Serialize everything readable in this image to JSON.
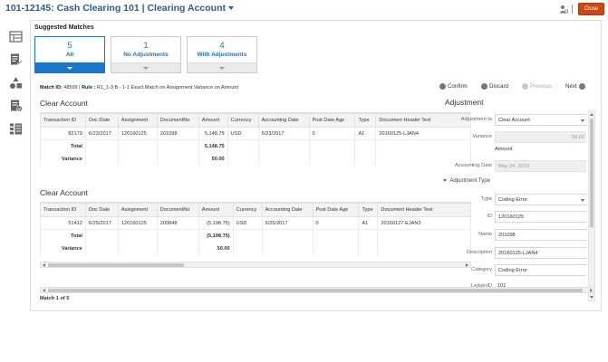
{
  "header": {
    "title": "101-12145: Cash Clearing 101 | Clearing Account",
    "close_label": "Close"
  },
  "suggested": {
    "title": "Suggested Matches",
    "tabs": [
      {
        "count": "5",
        "label": "All"
      },
      {
        "count": "1",
        "label": "No Adjustments"
      },
      {
        "count": "4",
        "label": "With Adjustments"
      }
    ]
  },
  "match": {
    "id_label": "Match ID:",
    "id_value": "48599",
    "rule_label": "Rule :",
    "rule_value": "R1_1-3 B - 1-1 Exact Match on Assignment Variance on Amount"
  },
  "actions": {
    "confirm": "Confirm",
    "discard": "Discard",
    "previous": "Previous",
    "next": "Next"
  },
  "table1": {
    "title": "Clear Account",
    "columns": [
      "Transaction ID",
      "Doc Date",
      "Assignment",
      "DocumentNo",
      "Amount",
      "Currency",
      "Accounting Date",
      "Post Date Age",
      "Type",
      "Document Header Text"
    ],
    "row": [
      "82179",
      "6/23/2017",
      "120160125",
      "201098",
      "5,148.75",
      "USD",
      "6/23/2017",
      "0",
      "A1",
      "20160125-LJAN4"
    ],
    "total_label": "Total",
    "total_value": "5,148.75",
    "variance_label": "Variance",
    "variance_value": "50.00"
  },
  "table2": {
    "title": "Clear Account",
    "columns": [
      "Transaction ID",
      "Doc Date",
      "Assignment",
      "DocumentNo",
      "Amount",
      "Currency",
      "Accounting Date",
      "Post Date Age",
      "Type",
      "Document Header Text"
    ],
    "row": [
      "51412",
      "6/25/2017",
      "120160125",
      "200848",
      "(5,198.75)",
      "USD",
      "6/25/2017",
      "0",
      "A1",
      "20160127-EJAN3"
    ],
    "total_label": "Total",
    "total_value": "(5,198.75)",
    "variance_label": "Variance",
    "variance_value": "50.00"
  },
  "adjustment": {
    "title": "Adjustment",
    "adjust_to_label": "Adjustment to",
    "adjust_to_value": "Clear Account",
    "variance_label": "Variance",
    "variance_value": "50.00",
    "amount_label": "Amount",
    "accounting_date_label": "Accounting Date",
    "accounting_date_value": "May 24, 2019",
    "type_section": "Adjustment Type",
    "type_label": "Type",
    "type_value": "Coding Error",
    "id_label": "ID",
    "id_value": "120160125",
    "name_label": "Name",
    "name_value": "201098",
    "description_label": "Description",
    "description_value": "20160125-LJAN4",
    "category_label": "Category",
    "category_value": "Coding Error",
    "ledger_label": "LedgerID",
    "ledger_value": "101"
  },
  "pager": "Match 1 of 5",
  "icons": [
    "user-settings-icon",
    "grid-view-icon",
    "edit-document-icon",
    "shapes-icon",
    "checklist-icon",
    "list-detail-icon"
  ],
  "colors": {
    "accent": "#1a76c6",
    "title": "#2e5c87",
    "close": "#c74a14"
  }
}
